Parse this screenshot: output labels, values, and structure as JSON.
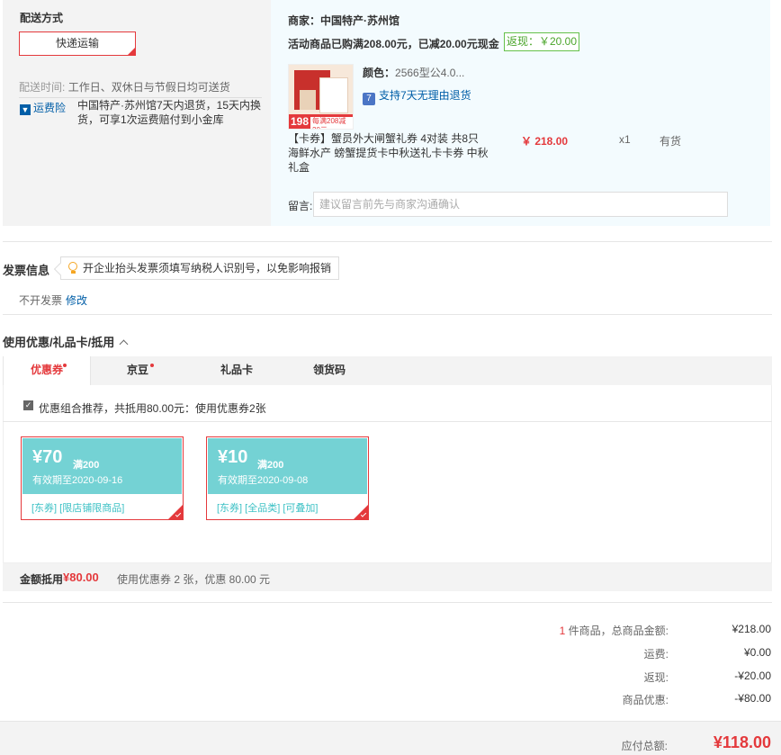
{
  "shipping": {
    "title": "配送方式",
    "method": "快递运输",
    "time_label": "配送时间:",
    "time_value": "工作日、双休日与节假日均可送货",
    "insurance_badge": "运费险",
    "insurance_text": "中国特产·苏州馆7天内退货，15天内换货，可享1次运费赔付到小金库"
  },
  "merchant": {
    "name": "商家：中国特产·苏州馆",
    "promo": "活动商品已购满208.00元，已减20.00元现金",
    "cashback": "返现：￥20.00"
  },
  "product": {
    "image_price": "198",
    "image_promo": "每满208减20元",
    "color_label": "颜色：",
    "color_value": "2566型公4.0...",
    "return_policy": "支持7天无理由退货",
    "name": "【卡券】蟹员外大闸蟹礼券 4对装 共8只 海鲜水产 螃蟹提货卡中秋送礼卡卡券 中秋礼盒",
    "price": "￥ 218.00",
    "qty": "x1",
    "stock": "有货"
  },
  "note": {
    "label": "留言:",
    "placeholder": "建议留言前先与商家沟通确认"
  },
  "invoice": {
    "title": "发票信息",
    "tip": "开企业抬头发票须填写纳税人识别号，以免影响报销",
    "status": "不开发票",
    "edit": "修改"
  },
  "coupons": {
    "title": "使用优惠/礼品卡/抵用",
    "tabs": [
      {
        "label": "优惠券",
        "dot": true
      },
      {
        "label": "京豆",
        "dot": true
      },
      {
        "label": "礼品卡",
        "dot": false
      },
      {
        "label": "领货码",
        "dot": false
      }
    ],
    "combo_text": "优惠组合推荐，共抵用80.00元：使用优惠券2张",
    "items": [
      {
        "amount": "¥70",
        "condition": "满200",
        "expiry": "有效期至2020-09-16",
        "tags": "[东券] [限店铺限商品]"
      },
      {
        "amount": "¥10",
        "condition": "满200",
        "expiry": "有效期至2020-09-08",
        "tags": "[东券] [全品类] [可叠加]"
      }
    ],
    "discount_label": "金额抵用",
    "discount_amount": "¥80.00",
    "discount_desc": "使用优惠券 2 张，优惠 80.00 元"
  },
  "summary": {
    "count": "1",
    "items_label": " 件商品，总商品金额:",
    "items_value": "¥218.00",
    "shipping_label": "运费:",
    "shipping_value": "¥0.00",
    "cashback_label": "返现:",
    "cashback_value": "-¥20.00",
    "discount_label": "商品优惠:",
    "discount_value": "-¥80.00",
    "total_label": "应付总额:",
    "total_value": "¥118.00"
  },
  "colors": {
    "accent": "#e4393c",
    "link": "#005ea7",
    "coupon": "#74d2d4",
    "cashback": "#4aa52a"
  }
}
